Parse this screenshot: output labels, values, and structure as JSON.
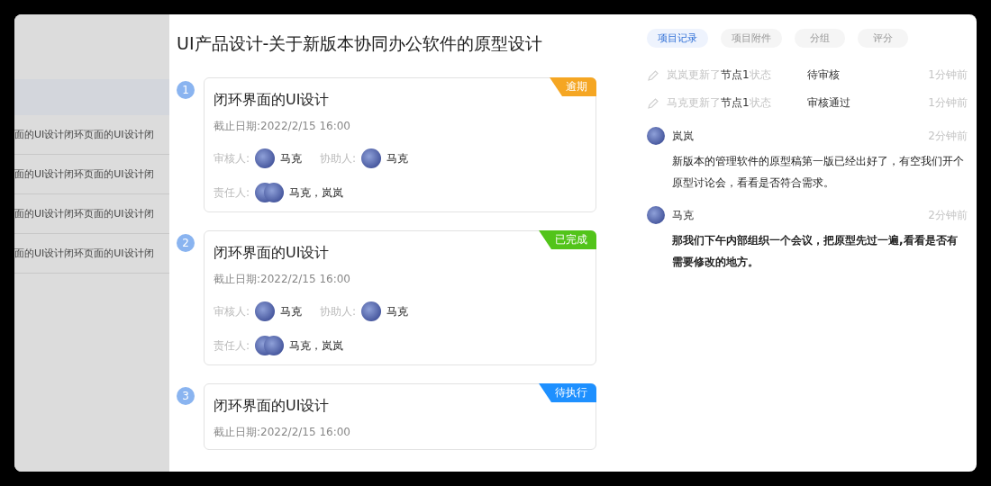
{
  "sidebar": {
    "items": [
      {
        "label": "面的UI设计闭环页面的UI设计闭"
      },
      {
        "label": "面的UI设计闭环页面的UI设计闭"
      },
      {
        "label": "面的UI设计闭环页面的UI设计闭"
      },
      {
        "label": "面的UI设计闭环页面的UI设计闭"
      }
    ]
  },
  "title": "UI产品设计-关于新版本协同办公软件的原型设计",
  "tasks": [
    {
      "index": "1",
      "title": "闭环界面的UI设计",
      "deadline": "截止日期:2022/2/15 16:00",
      "status": "逾期",
      "color": "#f5a623",
      "reviewer_label": "审核人:",
      "reviewer": "马克",
      "assistant_label": "协助人:",
      "assistant": "马克",
      "owner_label": "责任人:",
      "owners": "马克，岚岚"
    },
    {
      "index": "2",
      "title": "闭环界面的UI设计",
      "deadline": "截止日期:2022/2/15 16:00",
      "status": "已完成",
      "color": "#52c41a",
      "reviewer_label": "审核人:",
      "reviewer": "马克",
      "assistant_label": "协助人:",
      "assistant": "马克",
      "owner_label": "责任人:",
      "owners": "马克，岚岚"
    },
    {
      "index": "3",
      "title": "闭环界面的UI设计",
      "deadline": "截止日期:2022/2/15 16:00",
      "status": "待执行",
      "color": "#1e90ff"
    }
  ],
  "tabs": [
    {
      "label": "项目记录",
      "selected": true
    },
    {
      "label": "项目附件",
      "selected": false
    },
    {
      "label": "分组",
      "selected": false
    },
    {
      "label": "评分",
      "selected": false
    }
  ],
  "logs": [
    {
      "prefix": "岚岚更新了",
      "node": "节点1",
      "suffix": "状态",
      "status": "待审核",
      "time": "1分钟前"
    },
    {
      "prefix": "马克更新了",
      "node": "节点1",
      "suffix": "状态",
      "status": "审核通过",
      "time": "1分钟前"
    }
  ],
  "comments": [
    {
      "author": "岚岚",
      "time": "2分钟前",
      "text": "新版本的管理软件的原型稿第一版已经出好了，有空我们开个原型讨论会，看看是否符合需求。",
      "bold": false
    },
    {
      "author": "马克",
      "time": "2分钟前",
      "text": "那我们下午内部组织一个会议，把原型先过一遍,看看是否有需要修改的地方。",
      "bold": true
    }
  ]
}
